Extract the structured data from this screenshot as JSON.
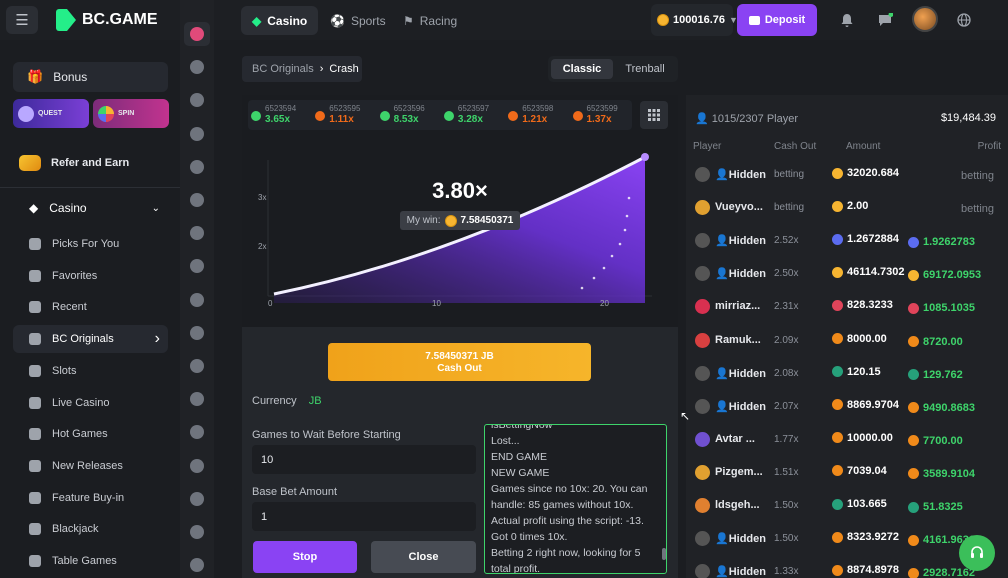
{
  "header": {
    "brand": "BC.GAME",
    "tabs": [
      {
        "label": "Casino",
        "active": true
      },
      {
        "label": "Sports",
        "active": false
      },
      {
        "label": "Racing",
        "active": false
      }
    ],
    "balance": "100016.76",
    "deposit_label": "Deposit"
  },
  "sidebar": {
    "bonus": "Bonus",
    "quest": "QUEST",
    "spin": "SPIN",
    "refer": "Refer and Earn",
    "casino": "Casino",
    "items": [
      {
        "label": "Picks For You"
      },
      {
        "label": "Favorites"
      },
      {
        "label": "Recent"
      },
      {
        "label": "BC Originals",
        "active": true
      },
      {
        "label": "Slots"
      },
      {
        "label": "Live Casino"
      },
      {
        "label": "Hot Games"
      },
      {
        "label": "New Releases"
      },
      {
        "label": "Feature Buy-in"
      },
      {
        "label": "Blackjack"
      },
      {
        "label": "Table Games"
      }
    ]
  },
  "breadcrumb": {
    "parent": "BC Originals",
    "current": "Crash"
  },
  "modes": {
    "classic": "Classic",
    "trenball": "Trenball"
  },
  "history": [
    {
      "id": "6523594",
      "value": "3.65x",
      "color": "#3ed46b"
    },
    {
      "id": "6523595",
      "value": "1.11x",
      "color": "#f06a1a"
    },
    {
      "id": "6523596",
      "value": "8.53x",
      "color": "#3ed46b"
    },
    {
      "id": "6523597",
      "value": "3.28x",
      "color": "#3ed46b"
    },
    {
      "id": "6523598",
      "value": "1.21x",
      "color": "#f06a1a"
    },
    {
      "id": "6523599",
      "value": "1.37x",
      "color": "#f06a1a"
    }
  ],
  "game": {
    "multiplier": "3.80×",
    "my_win_label": "My win:",
    "my_win_value": "7.58450371",
    "y_ticks": [
      "3x",
      "2x"
    ],
    "x_ticks": [
      "0",
      "10",
      "20"
    ]
  },
  "cashout": {
    "amount": "7.58450371 JB",
    "label": "Cash Out"
  },
  "form": {
    "currency_label": "Currency",
    "currency_value": "JB",
    "wait_label": "Games to Wait Before Starting",
    "wait_value": "10",
    "base_label": "Base Bet Amount",
    "base_value": "1",
    "stop": "Stop",
    "close": "Close"
  },
  "console": [
    "isBettingNow",
    "Lost...",
    "END GAME",
    "NEW GAME",
    "Games since no 10x: 20. You can",
    "handle: 85 games without 10x.",
    "Actual profit using the script: -13.",
    "Got 0 times 10x.",
    "Betting 2 right now, looking for 5",
    "total profit."
  ],
  "players": {
    "count": "1015/2307 Player",
    "total": "$19,484.39",
    "columns": [
      "Player",
      "Cash Out",
      "Amount",
      "Profit"
    ],
    "rows": [
      {
        "name": "Hidden",
        "hidden": true,
        "cash": "betting",
        "amount": "32020.684",
        "atok": "#f7b531",
        "profit": "betting",
        "ptok": "",
        "av": "#555"
      },
      {
        "name": "Vueyvo...",
        "hidden": false,
        "cash": "betting",
        "amount": "2.00",
        "atok": "#f7b531",
        "profit": "betting",
        "ptok": "",
        "av": "#e0a030"
      },
      {
        "name": "Hidden",
        "hidden": true,
        "cash": "2.52x",
        "amount": "1.2672884",
        "atok": "#5b6cf0",
        "profit": "1.9262783",
        "ptok": "#5b6cf0",
        "av": "#555"
      },
      {
        "name": "Hidden",
        "hidden": true,
        "cash": "2.50x",
        "amount": "46114.7302",
        "atok": "#f7b531",
        "profit": "69172.0953",
        "ptok": "#f7b531",
        "av": "#555"
      },
      {
        "name": "mirriaz...",
        "hidden": false,
        "cash": "2.31x",
        "amount": "828.3233",
        "atok": "#e0445a",
        "profit": "1085.1035",
        "ptok": "#e0445a",
        "av": "#d83050"
      },
      {
        "name": "Ramuk...",
        "hidden": false,
        "cash": "2.09x",
        "amount": "8000.00",
        "atok": "#f08a1a",
        "profit": "8720.00",
        "ptok": "#f08a1a",
        "av": "#d84040"
      },
      {
        "name": "Hidden",
        "hidden": true,
        "cash": "2.08x",
        "amount": "120.15",
        "atok": "#26a17b",
        "profit": "129.762",
        "ptok": "#26a17b",
        "av": "#555"
      },
      {
        "name": "Hidden",
        "hidden": true,
        "cash": "2.07x",
        "amount": "8869.9704",
        "atok": "#f08a1a",
        "profit": "9490.8683",
        "ptok": "#f08a1a",
        "av": "#555"
      },
      {
        "name": "Avtar ...",
        "hidden": false,
        "cash": "1.77x",
        "amount": "10000.00",
        "atok": "#f08a1a",
        "profit": "7700.00",
        "ptok": "#f08a1a",
        "av": "#7050d0"
      },
      {
        "name": "Pizgem...",
        "hidden": false,
        "cash": "1.51x",
        "amount": "7039.04",
        "atok": "#f08a1a",
        "profit": "3589.9104",
        "ptok": "#f08a1a",
        "av": "#e0a030"
      },
      {
        "name": "ldsgeh...",
        "hidden": false,
        "cash": "1.50x",
        "amount": "103.665",
        "atok": "#26a17b",
        "profit": "51.8325",
        "ptok": "#26a17b",
        "av": "#e08030"
      },
      {
        "name": "Hidden",
        "hidden": true,
        "cash": "1.50x",
        "amount": "8323.9272",
        "atok": "#f08a1a",
        "profit": "4161.9636",
        "ptok": "#f08a1a",
        "av": "#555"
      },
      {
        "name": "Hidden",
        "hidden": true,
        "cash": "1.33x",
        "amount": "8874.8978",
        "atok": "#f08a1a",
        "profit": "2928.7162",
        "ptok": "#f08a1a",
        "av": "#555"
      }
    ]
  }
}
